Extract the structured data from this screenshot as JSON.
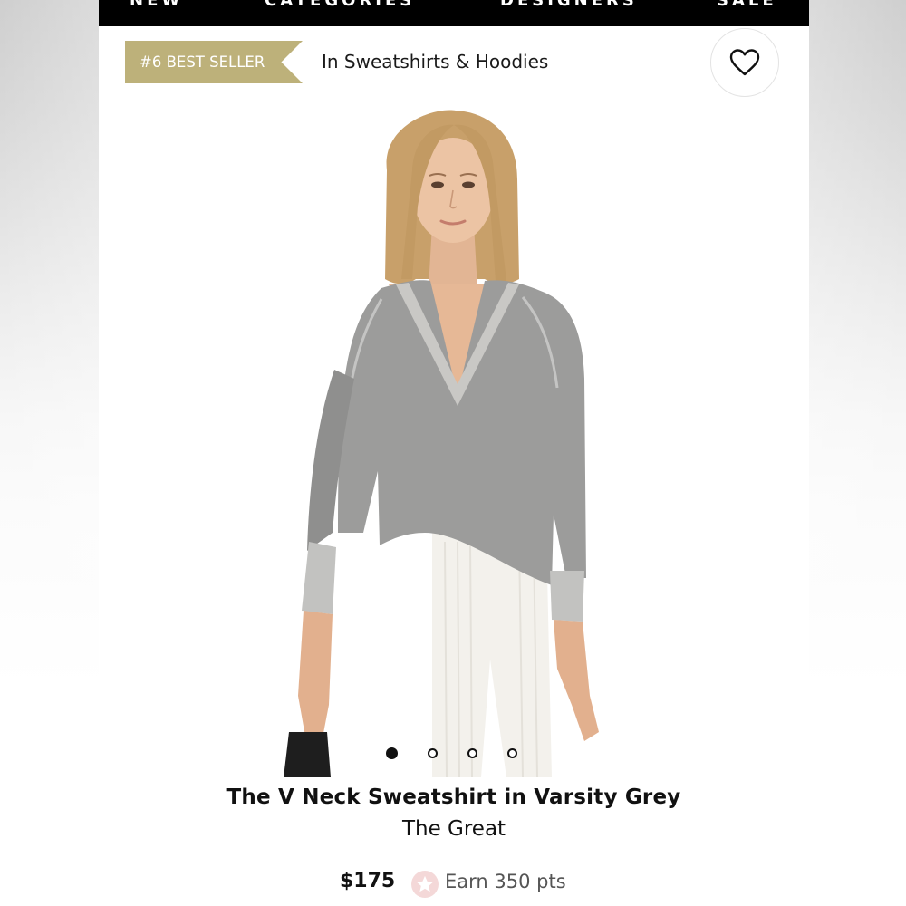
{
  "nav": {
    "items": [
      "NEW",
      "CATEGORIES",
      "DESIGNERS",
      "SALE"
    ]
  },
  "badge": {
    "label": "#6 BEST SELLER",
    "category": "In Sweatshirts & Hoodies",
    "color": "#bdb17a"
  },
  "wishlist": {
    "icon": "heart-icon"
  },
  "gallery": {
    "image_count": 4,
    "active_index": 0
  },
  "product": {
    "title": "The V Neck Sweatshirt in Varsity Grey",
    "brand": "The Great",
    "price": "$175",
    "points_icon": "star-icon",
    "points_label": "Earn 350 pts"
  },
  "colors": {
    "nav_background": "#000000",
    "points_badge": "#f4d8d8"
  }
}
